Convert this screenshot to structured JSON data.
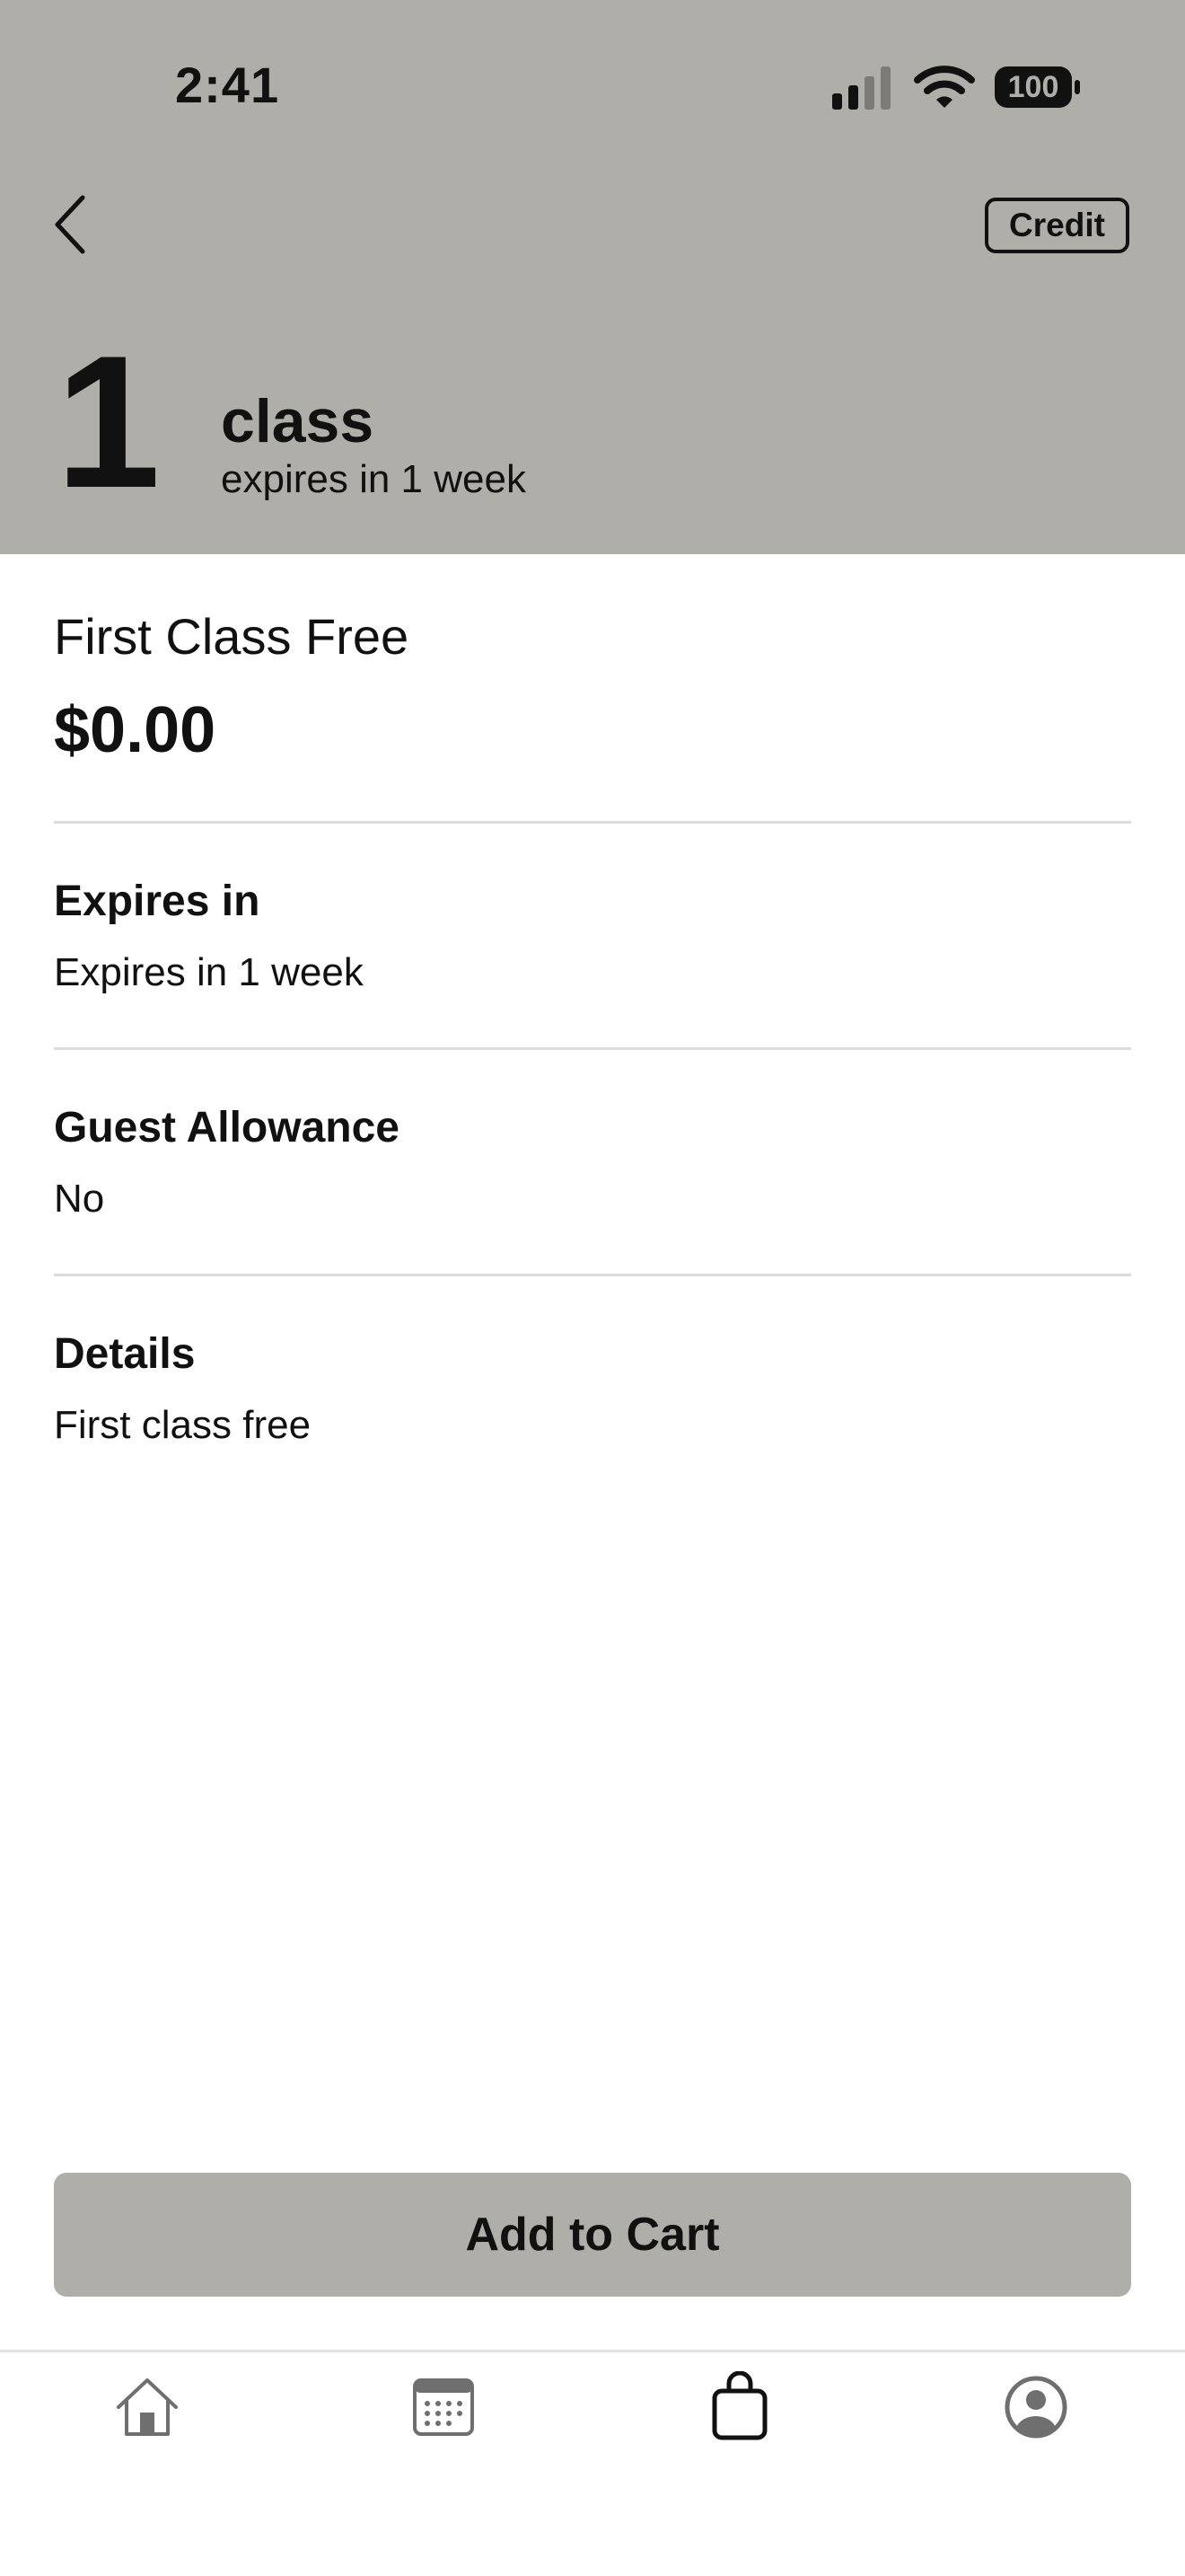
{
  "status_bar": {
    "time": "2:41",
    "battery": "100"
  },
  "header": {
    "badge": "Credit",
    "count": "1",
    "unit": "class",
    "expiry": "expires in 1 week"
  },
  "product": {
    "name": "First Class Free",
    "price": "$0.00"
  },
  "sections": [
    {
      "title": "Expires in",
      "value": "Expires in 1 week"
    },
    {
      "title": "Guest Allowance",
      "value": "No"
    },
    {
      "title": "Details",
      "value": "First class free"
    }
  ],
  "cta": {
    "label": "Add to Cart"
  },
  "tabs": [
    {
      "icon": "home-icon",
      "active": false
    },
    {
      "icon": "calendar-icon",
      "active": false
    },
    {
      "icon": "shopping-bag-icon",
      "active": true
    },
    {
      "icon": "profile-icon",
      "active": false
    }
  ],
  "colors": {
    "header_background": "#afaea9",
    "button_background": "#afaea9",
    "text": "#111111",
    "inactive_icon": "#6f6f6f",
    "divider": "#dcdcdc"
  }
}
